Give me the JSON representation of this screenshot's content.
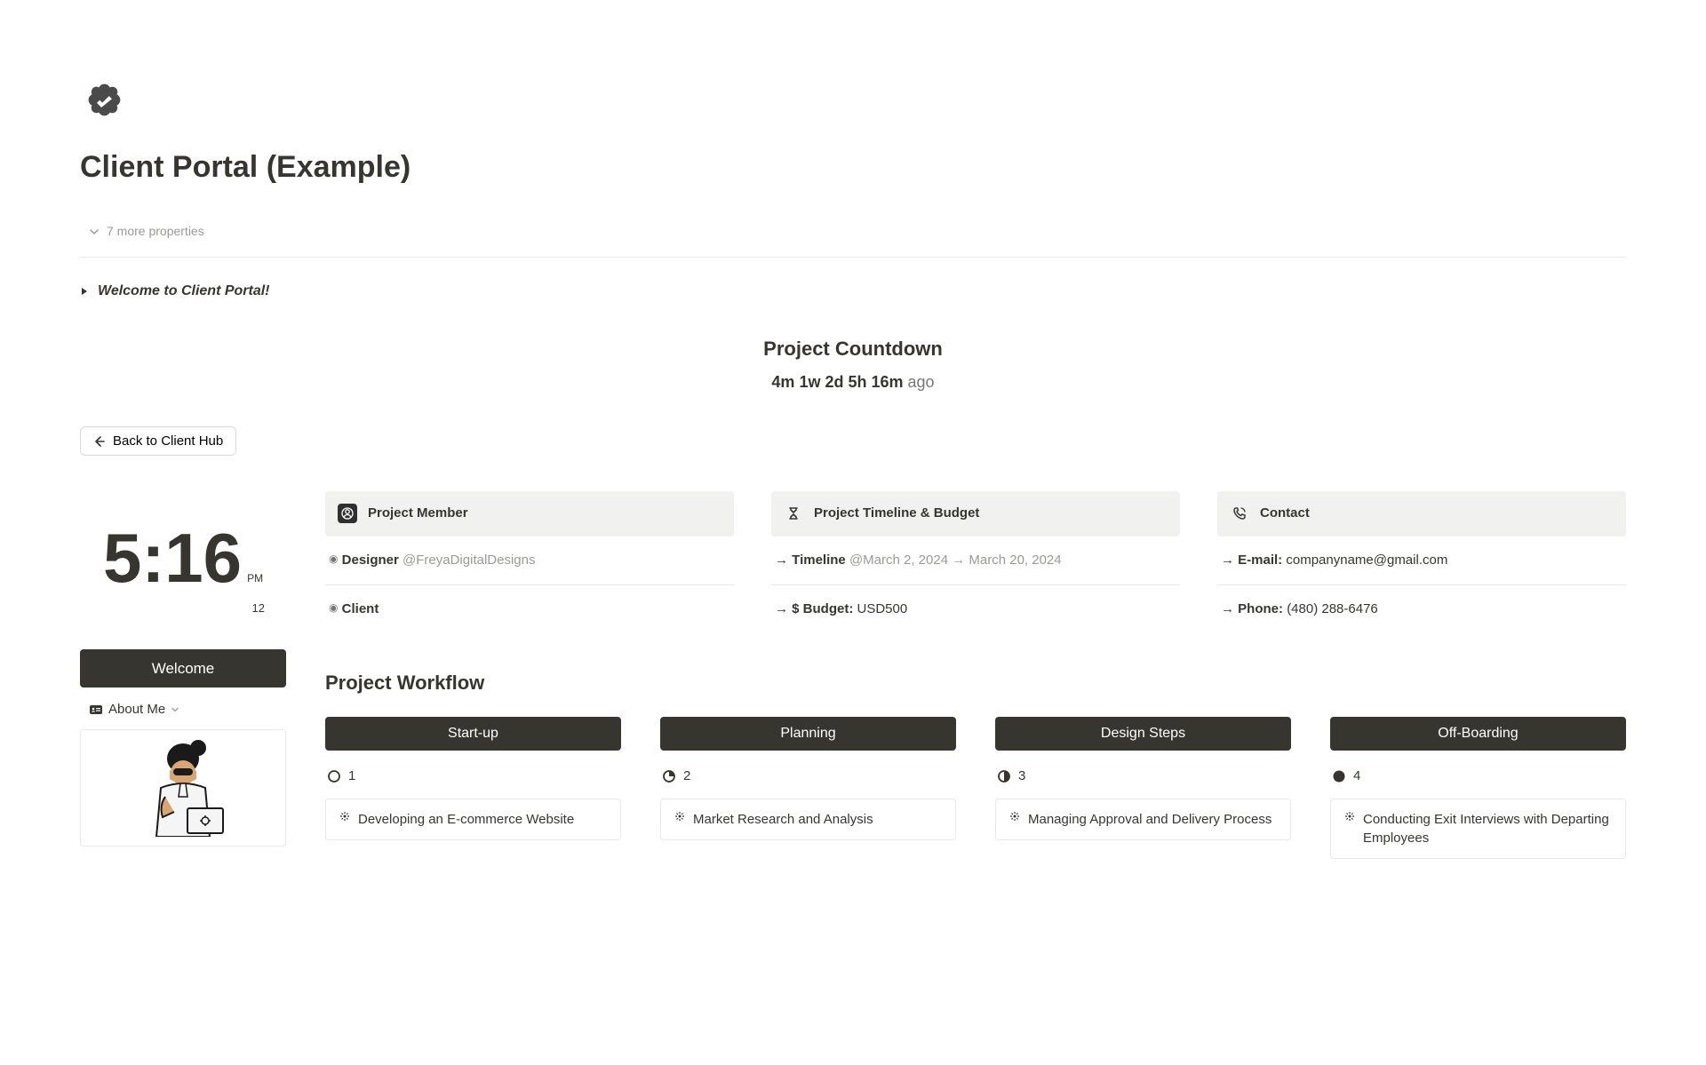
{
  "page_title": "Client Portal (Example)",
  "more_properties": "7 more properties",
  "welcome_toggle": "Welcome to Client Portal!",
  "countdown": {
    "title": "Project Countdown",
    "value": "4m 1w 2d 5h 16m",
    "suffix": "ago"
  },
  "back_button": "Back to Client Hub",
  "clock": {
    "time": "5:16",
    "period": "PM",
    "date": "12"
  },
  "sidebar": {
    "welcome": "Welcome",
    "about_me": "About Me"
  },
  "cards": {
    "member": {
      "title": "Project Member",
      "designer_label": "Designer",
      "designer_mention": "@FreyaDigitalDesigns",
      "client_label": "Client"
    },
    "timeline": {
      "title": "Project Timeline & Budget",
      "timeline_label": "Timeline",
      "timeline_value": "@March 2, 2024 → March 20, 2024",
      "budget_label": "$ Budget:",
      "budget_value": "USD500"
    },
    "contact": {
      "title": "Contact",
      "email_label": "E-mail:",
      "email_value": "companyname@gmail.com",
      "phone_label": "Phone:",
      "phone_value": "(480) 288-6476"
    }
  },
  "workflow": {
    "title": "Project Workflow",
    "columns": [
      {
        "name": "Start-up",
        "status_num": "1",
        "card": "Developing an E-commerce Website"
      },
      {
        "name": "Planning",
        "status_num": "2",
        "card": "Market Research and Analysis"
      },
      {
        "name": "Design Steps",
        "status_num": "3",
        "card": "Managing Approval and Delivery Process"
      },
      {
        "name": "Off-Boarding",
        "status_num": "4",
        "card": "Conducting Exit Interviews with Departing Employees"
      }
    ]
  }
}
